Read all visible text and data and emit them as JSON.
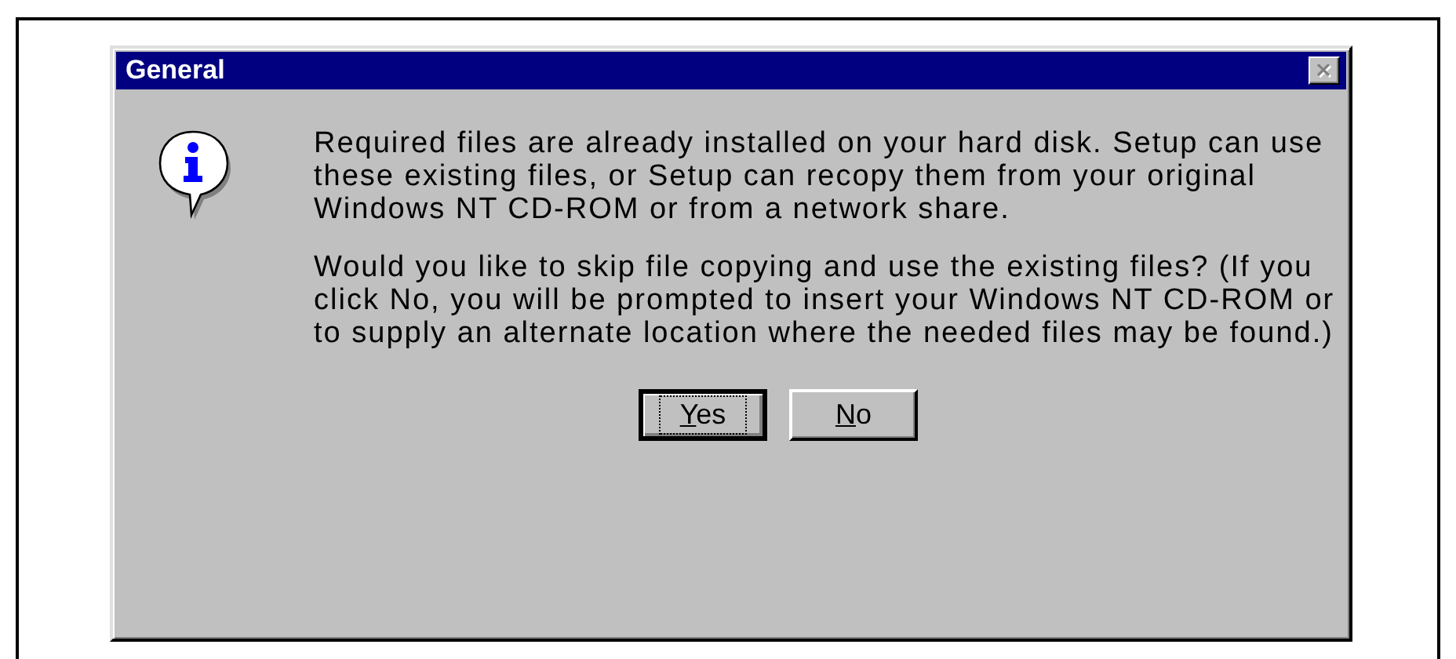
{
  "window": {
    "title": "General",
    "close_disabled": true
  },
  "messages": [
    "Required files are already installed on your hard disk. Setup can use these existing files, or Setup can recopy them from your original Windows NT CD-ROM or from a network share.",
    "Would you like to skip file copying and use the existing files? (If you click No, you will be prompted to insert your Windows NT CD-ROM or to supply an alternate location where the needed files may be found.)"
  ],
  "buttons": [
    {
      "label": "Yes",
      "focused": true
    },
    {
      "label": "No",
      "focused": false
    }
  ]
}
